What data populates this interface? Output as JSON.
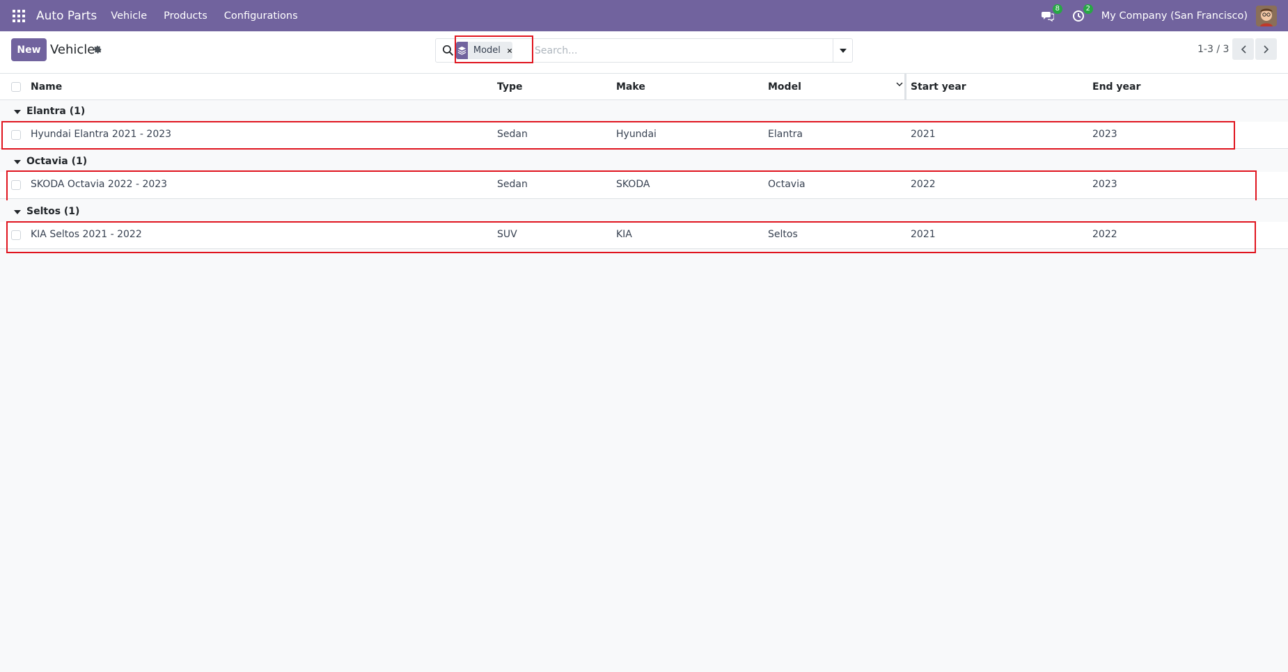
{
  "navbar": {
    "app_name": "Auto Parts",
    "menu": [
      "Vehicle",
      "Products",
      "Configurations"
    ],
    "messages_count": "8",
    "activities_count": "2",
    "company": "My Company (San Francisco)"
  },
  "control": {
    "new_label": "New",
    "title": "Vehicle",
    "facet_label": "Model",
    "search_placeholder": "Search...",
    "pager": "1-3 / 3"
  },
  "columns": [
    "Name",
    "Type",
    "Make",
    "Model",
    "Start year",
    "End year"
  ],
  "groups": [
    {
      "label": "Elantra (1)",
      "rows": [
        {
          "name": "Hyundai Elantra 2021 - 2023",
          "type": "Sedan",
          "make": "Hyundai",
          "model": "Elantra",
          "start": "2021",
          "end": "2023"
        }
      ]
    },
    {
      "label": "Octavia (1)",
      "rows": [
        {
          "name": "SKODA Octavia 2022 - 2023",
          "type": "Sedan",
          "make": "SKODA",
          "model": "Octavia",
          "start": "2022",
          "end": "2023"
        }
      ]
    },
    {
      "label": "Seltos (1)",
      "rows": [
        {
          "name": "KIA Seltos 2021 - 2022",
          "type": "SUV",
          "make": "KIA",
          "model": "Seltos",
          "start": "2021",
          "end": "2022"
        }
      ]
    }
  ],
  "colors": {
    "brand": "#71639e",
    "highlight": "#e0141e",
    "badge": "#28a745"
  }
}
